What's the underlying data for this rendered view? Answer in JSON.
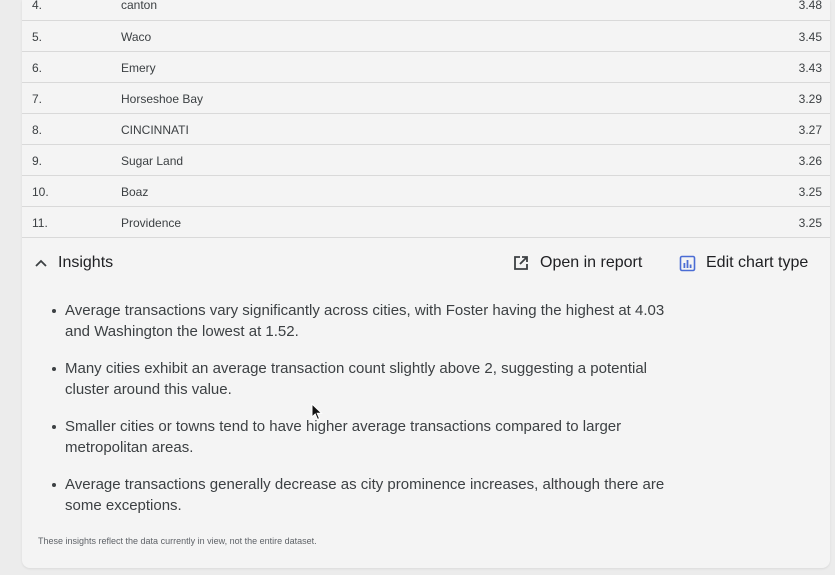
{
  "table": {
    "rows": [
      {
        "rank": "4.",
        "city": "canton",
        "value": "3.48"
      },
      {
        "rank": "5.",
        "city": "Waco",
        "value": "3.45"
      },
      {
        "rank": "6.",
        "city": "Emery",
        "value": "3.43"
      },
      {
        "rank": "7.",
        "city": "Horseshoe Bay",
        "value": "3.29"
      },
      {
        "rank": "8.",
        "city": "CINCINNATI",
        "value": "3.27"
      },
      {
        "rank": "9.",
        "city": "Sugar Land",
        "value": "3.26"
      },
      {
        "rank": "10.",
        "city": "Boaz",
        "value": "3.25"
      },
      {
        "rank": "11.",
        "city": "Providence",
        "value": "3.25"
      }
    ]
  },
  "insights": {
    "title": "Insights",
    "open_in_report": "Open in report",
    "edit_chart_type": "Edit chart type",
    "bullets": [
      "Average transactions vary significantly across cities, with Foster having the highest at 4.03 and Washington the lowest at 1.52.",
      "Many cities exhibit an average transaction count slightly above 2, suggesting a potential cluster around this value.",
      "Smaller cities or towns tend to have higher average transactions compared to larger metropolitan areas.",
      "Average transactions generally decrease as city prominence increases, although there are some exceptions."
    ],
    "footnote": "These insights reflect the data currently in view, not the entire dataset."
  },
  "colors": {
    "page_bg": "#ececec",
    "card_bg": "#f4f4f4",
    "accent_blue": "#4a6cd4"
  },
  "icons": {
    "collapse": "chevron-up-icon",
    "open": "open-in-new-icon",
    "edit": "bar-chart-icon"
  }
}
